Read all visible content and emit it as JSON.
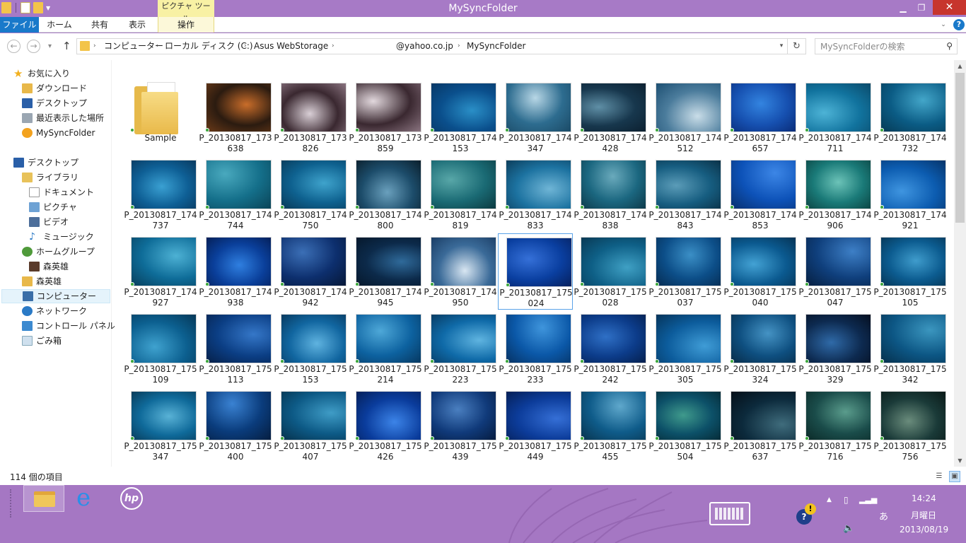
{
  "window": {
    "title": "MySyncFolder",
    "context_group": "ピクチャ ツール"
  },
  "ribbon": {
    "tabs": [
      "ファイル",
      "ホーム",
      "共有",
      "表示"
    ],
    "context_tab": "操作"
  },
  "address": {
    "segments": [
      "コンピューター",
      "ローカル ディスク (C:)",
      "Asus WebStorage",
      "@yahoo.co.jp",
      "MySyncFolder"
    ],
    "search_placeholder": "MySyncFolderの検索"
  },
  "nav": {
    "favorites_header": "お気に入り",
    "favorites": [
      "ダウンロード",
      "デスクトップ",
      "最近表示した場所",
      "MySyncFolder"
    ],
    "desktop": "デスクトップ",
    "library": "ライブラリ",
    "library_items": [
      "ドキュメント",
      "ピクチャ",
      "ビデオ",
      "ミュージック"
    ],
    "homegroup": "ホームグループ",
    "homegroup_user": "森英雄",
    "user": "森英雄",
    "computer": "コンピューター",
    "network": "ネットワーク",
    "control_panel": "コントロール パネル",
    "recycle": "ごみ箱"
  },
  "files": [
    {
      "name": "Sample",
      "type": "folder"
    },
    {
      "name": "P_20130817_173638",
      "colors": [
        "#2b1b10",
        "#c96d2a",
        "#6a3a18"
      ]
    },
    {
      "name": "P_20130817_173826",
      "colors": [
        "#3a2830",
        "#d9cfd6",
        "#8a7480"
      ]
    },
    {
      "name": "P_20130817_173859",
      "colors": [
        "#3a2830",
        "#e2d8dd",
        "#8a7480"
      ]
    },
    {
      "name": "P_20130817_174153",
      "colors": [
        "#0a4f8c",
        "#2a8fc7",
        "#083866"
      ]
    },
    {
      "name": "P_20130817_174347",
      "colors": [
        "#2d6c8f",
        "#b8d7e6",
        "#1b4a66"
      ]
    },
    {
      "name": "P_20130817_174428",
      "colors": [
        "#17374d",
        "#5f8fa6",
        "#0c2030"
      ]
    },
    {
      "name": "P_20130817_174512",
      "colors": [
        "#4b7c9c",
        "#c9dde8",
        "#1d4f72"
      ]
    },
    {
      "name": "P_20130817_174657",
      "colors": [
        "#1650b0",
        "#3384e0",
        "#0a2c78"
      ]
    },
    {
      "name": "P_20130817_174711",
      "colors": [
        "#11739e",
        "#4db3d6",
        "#0b4a6a"
      ]
    },
    {
      "name": "P_20130817_174732",
      "colors": [
        "#0b5c85",
        "#43a6c9",
        "#063a55"
      ]
    },
    {
      "name": "P_20130817_174737",
      "colors": [
        "#0e5f95",
        "#3aa0d2",
        "#0a3a60"
      ]
    },
    {
      "name": "P_20130817_174744",
      "colors": [
        "#146f8a",
        "#49a9be",
        "#0b4457"
      ]
    },
    {
      "name": "P_20130817_174750",
      "colors": [
        "#0e618f",
        "#3fa3cc",
        "#093a58"
      ]
    },
    {
      "name": "P_20130817_174800",
      "colors": [
        "#1c4c6a",
        "#6aa0bd",
        "#0b1f2c"
      ]
    },
    {
      "name": "P_20130817_174819",
      "colors": [
        "#1a6a74",
        "#58a7a8",
        "#0b3a40"
      ]
    },
    {
      "name": "P_20130817_174833",
      "colors": [
        "#1c72a0",
        "#6fb5d6",
        "#0c3e5c"
      ]
    },
    {
      "name": "P_20130817_174838",
      "colors": [
        "#1b6780",
        "#6aaabc",
        "#0d3a4a"
      ]
    },
    {
      "name": "P_20130817_174843",
      "colors": [
        "#165d80",
        "#5b9cb8",
        "#0b3248"
      ]
    },
    {
      "name": "P_20130817_174853",
      "colors": [
        "#0d52b8",
        "#3c86e6",
        "#08306e"
      ]
    },
    {
      "name": "P_20130817_174906",
      "colors": [
        "#1a7a78",
        "#6cc3b8",
        "#0c4644"
      ]
    },
    {
      "name": "P_20130817_174921",
      "colors": [
        "#0c5cb0",
        "#3f95e0",
        "#06346a"
      ]
    },
    {
      "name": "P_20130817_174927",
      "colors": [
        "#0e6c98",
        "#4db1d4",
        "#083f5c"
      ]
    },
    {
      "name": "P_20130817_174938",
      "colors": [
        "#0a3f9a",
        "#2f7fe0",
        "#051f58"
      ]
    },
    {
      "name": "P_20130817_174942",
      "colors": [
        "#0d2f6e",
        "#3b6fb6",
        "#061838"
      ]
    },
    {
      "name": "P_20130817_174945",
      "colors": [
        "#0c2a4a",
        "#2f6a9a",
        "#06182c"
      ]
    },
    {
      "name": "P_20130817_174950",
      "colors": [
        "#3a6a98",
        "#d8e6f2",
        "#1b3e66"
      ]
    },
    {
      "name": "P_20130817_175024",
      "colors": [
        "#0a3fa0",
        "#3570d8",
        "#061f5c"
      ]
    },
    {
      "name": "P_20130817_175028",
      "colors": [
        "#0e5f86",
        "#3fa0c4",
        "#093954"
      ]
    },
    {
      "name": "P_20130817_175037",
      "colors": [
        "#0c4e88",
        "#3b8fc6",
        "#062c52"
      ]
    },
    {
      "name": "P_20130817_175040",
      "colors": [
        "#0b5a90",
        "#43a2d4",
        "#063456"
      ]
    },
    {
      "name": "P_20130817_175047",
      "colors": [
        "#0f3f7c",
        "#3d7fc6",
        "#061f40"
      ]
    },
    {
      "name": "P_20130817_175105",
      "colors": [
        "#0c5c90",
        "#3f9ccc",
        "#063656"
      ]
    },
    {
      "name": "P_20130817_175109",
      "colors": [
        "#0c6090",
        "#3fa2cf",
        "#063858"
      ]
    },
    {
      "name": "P_20130817_175113",
      "colors": [
        "#0b3e84",
        "#3577c8",
        "#062048"
      ]
    },
    {
      "name": "P_20130817_175153",
      "colors": [
        "#1166a0",
        "#5fb3e0",
        "#083a60"
      ]
    },
    {
      "name": "P_20130817_175214",
      "colors": [
        "#0d62a0",
        "#4ea8d8",
        "#073860"
      ]
    },
    {
      "name": "P_20130817_175223",
      "colors": [
        "#0f6aa8",
        "#5fb4e0",
        "#083c64"
      ]
    },
    {
      "name": "P_20130817_175233",
      "colors": [
        "#0b58a8",
        "#3f95dc",
        "#063262"
      ]
    },
    {
      "name": "P_20130817_175242",
      "colors": [
        "#0c3c8a",
        "#2f70c6",
        "#05204e"
      ]
    },
    {
      "name": "P_20130817_175305",
      "colors": [
        "#0c5c9c",
        "#3f9cd6",
        "#06345a"
      ]
    },
    {
      "name": "P_20130817_175324",
      "colors": [
        "#0e4f80",
        "#4593c4",
        "#082c48"
      ]
    },
    {
      "name": "P_20130817_175329",
      "colors": [
        "#0d2a50",
        "#2f6aa8",
        "#050f20"
      ]
    },
    {
      "name": "P_20130817_175342",
      "colors": [
        "#0c5684",
        "#3b96bf",
        "#06304c"
      ]
    },
    {
      "name": "P_20130817_175347",
      "colors": [
        "#0f6a9a",
        "#59b2d6",
        "#083c5a"
      ]
    },
    {
      "name": "P_20130817_175400",
      "colors": [
        "#0a3c7c",
        "#3a82d2",
        "#061e40"
      ]
    },
    {
      "name": "P_20130817_175407",
      "colors": [
        "#0d5a86",
        "#3f9cc6",
        "#06324c"
      ]
    },
    {
      "name": "P_20130817_175426",
      "colors": [
        "#0a3c9c",
        "#3c84e8",
        "#05205a"
      ]
    },
    {
      "name": "P_20130817_175439",
      "colors": [
        "#103a7a",
        "#4a7fc0",
        "#061c40"
      ]
    },
    {
      "name": "P_20130817_175449",
      "colors": [
        "#0c3c9a",
        "#356fd6",
        "#051f56"
      ]
    },
    {
      "name": "P_20130817_175455",
      "colors": [
        "#0f5c8a",
        "#5fa8cc",
        "#08344e"
      ]
    },
    {
      "name": "P_20130817_175504",
      "colors": [
        "#0c5068",
        "#3f9a8c",
        "#062c38"
      ]
    },
    {
      "name": "P_20130817_175637",
      "colors": [
        "#0c2a3c",
        "#3f6c7c",
        "#050f18"
      ]
    },
    {
      "name": "P_20130817_175716",
      "colors": [
        "#1a4c4a",
        "#5a9c8c",
        "#0b2a28"
      ]
    },
    {
      "name": "P_20130817_175756",
      "colors": [
        "#1a3a38",
        "#6a8c7c",
        "#0a1a18"
      ]
    }
  ],
  "status": {
    "count": "114 個の項目"
  },
  "taskbar": {
    "time": "14:24",
    "weekday": "月曜日",
    "date": "2013/08/19",
    "ime": "あ"
  }
}
